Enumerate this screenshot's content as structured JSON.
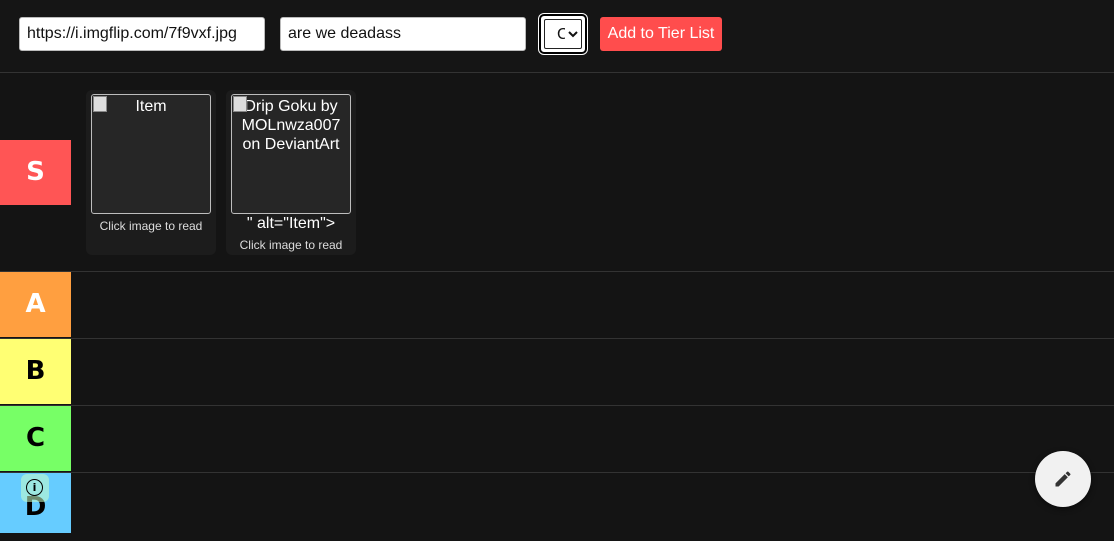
{
  "topbar": {
    "url_value": "https://i.imgflip.com/7f9vxf.jpg",
    "text_value": "are we deadass",
    "tier_select": {
      "selected": "C",
      "options": [
        "S",
        "A",
        "B",
        "C",
        "D"
      ]
    },
    "add_button_label": "Add to Tier List",
    "add_button_color": "#ff4d4d"
  },
  "tiers": [
    {
      "label": "S",
      "color": "#ff5555"
    },
    {
      "label": "A",
      "color": "#ff9f40"
    },
    {
      "label": "B",
      "color": "#ffff73"
    },
    {
      "label": "C",
      "color": "#77ff66"
    },
    {
      "label": "D",
      "color": "#66ccff"
    }
  ],
  "items": [
    {
      "alt": "Item",
      "extra": "",
      "hint": "Click image to read"
    },
    {
      "alt": "Drip Goku by MOLnwza007 on DeviantArt",
      "extra": "\" alt=\"Item\">",
      "hint": "Click image to read"
    }
  ],
  "icons": {
    "info": "info-icon",
    "edit": "pencil-icon"
  },
  "info_glyph": "i"
}
